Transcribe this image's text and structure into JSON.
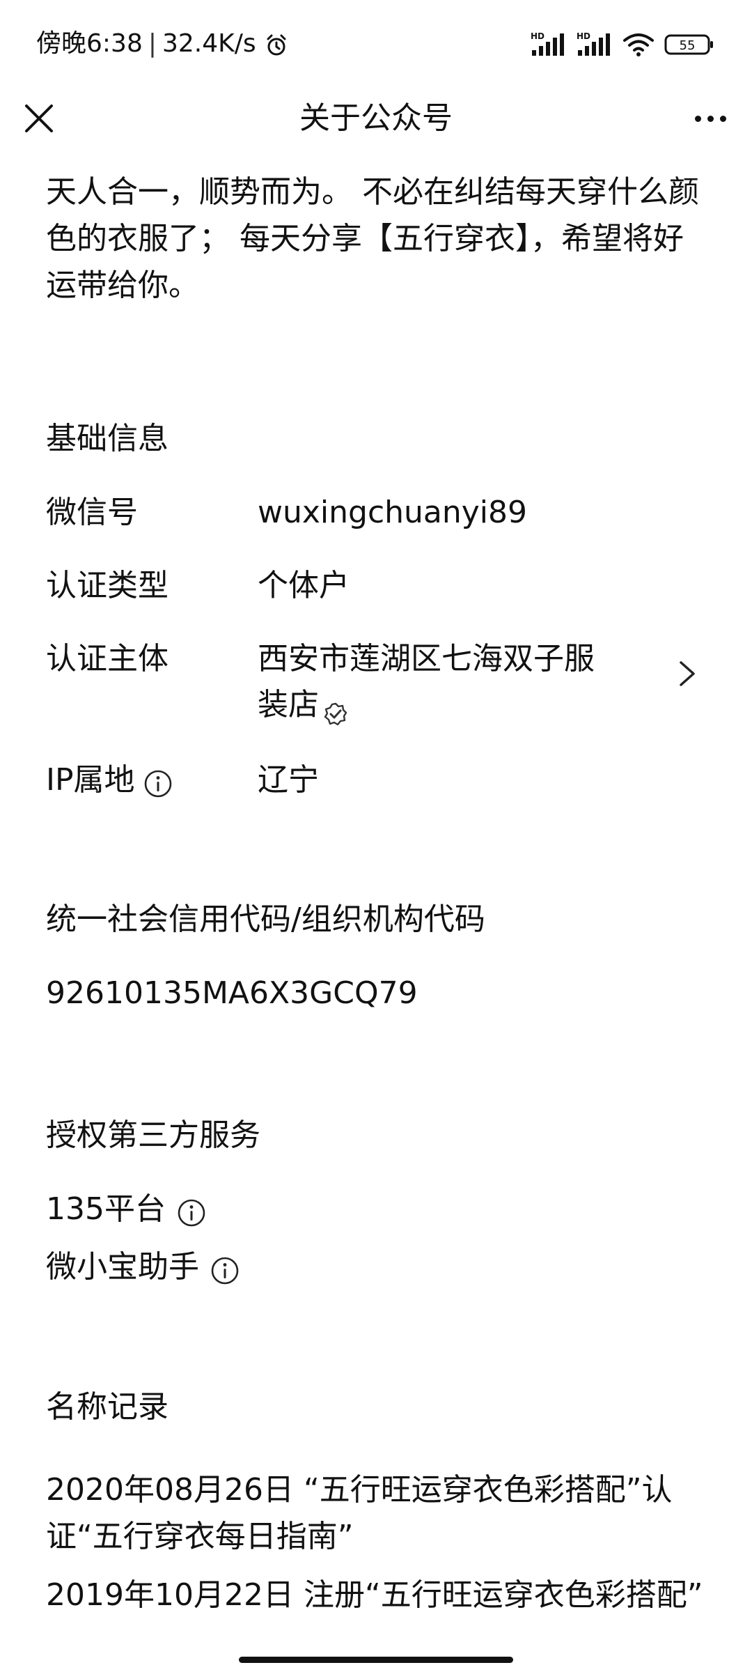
{
  "status_bar": {
    "time": "傍晚6:38",
    "separator": "|",
    "net_speed": "32.4K/s",
    "signal_label_1": "HD",
    "signal_label_2": "HD",
    "battery_level": "55"
  },
  "nav": {
    "title": "关于公众号"
  },
  "intro": {
    "text": "天人合一，顺势而为。 不必在纠结每天穿什么颜色的衣服了； 每天分享【五行穿衣】，希望将好运带给你。"
  },
  "basic_info": {
    "title": "基础信息",
    "rows": [
      {
        "label": "微信号",
        "value": "wuxingchuanyi89"
      },
      {
        "label": "认证类型",
        "value": "个体户"
      },
      {
        "label": "认证主体",
        "value_line1": "西安市莲湖区七海双子服",
        "value_line2": "装店"
      },
      {
        "label": "IP属地",
        "value": "辽宁"
      }
    ]
  },
  "credit_code": {
    "title": "统一社会信用代码/组织机构代码",
    "value": "92610135MA6X3GCQ79"
  },
  "third_party": {
    "title": "授权第三方服务",
    "items": [
      {
        "label": "135平台"
      },
      {
        "label": "微小宝助手"
      }
    ]
  },
  "name_records": {
    "title": "名称记录",
    "records": [
      "2020年08月26日 “五行旺运穿衣色彩搭配”认证“五行穿衣每日指南”",
      "2019年10月22日 注册“五行旺运穿衣色彩搭配”"
    ]
  }
}
